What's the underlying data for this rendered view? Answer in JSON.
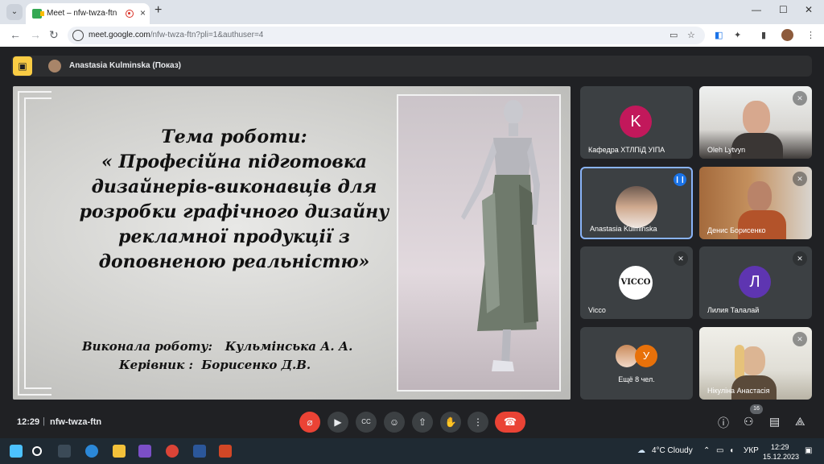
{
  "browser": {
    "tab_title": "Meet – nfw-twza-ftn",
    "url_host": "meet.google.com",
    "url_rest": "/nfw-twza-ftn?pli=1&authuser=4"
  },
  "meet": {
    "presenter_label": "Anastasia Kulminska (Показ)",
    "slide": {
      "title_lines": [
        "Тема роботи:",
        "« Професійна підготовка",
        "дизайнерів-виконавців для",
        "розробки графічного дизайну",
        "рекламної продукції з",
        "доповненою реальністю»"
      ],
      "credits": [
        "Виконала роботу:   Кульмінська А. А.",
        "Керівник :  Борисенко Д.В."
      ]
    },
    "tiles": [
      {
        "name": "Кафедра ХТЛПіД УІПА",
        "initial": "K",
        "color": "#c2185b"
      },
      {
        "name": "Oleh Lytvyn"
      },
      {
        "name": "Anastasia Kulminska"
      },
      {
        "name": "Денис Борисенко"
      },
      {
        "name": "Vicco",
        "logo": "VICCO"
      },
      {
        "name": "Лилия Талалай",
        "initial": "Л",
        "color": "#5e35b1"
      },
      {
        "name": "Ещё 8 чел.",
        "initial": "У",
        "color": "#e8710a"
      },
      {
        "name": "Нікуліна Анастасія"
      }
    ],
    "time": "12:29",
    "meeting_code": "nfw-twza-ftn",
    "participant_count": "16"
  },
  "taskbar": {
    "weather": "4°C  Cloudy",
    "lang": "УКР",
    "clock_time": "12:29",
    "clock_date": "15.12.2023"
  }
}
